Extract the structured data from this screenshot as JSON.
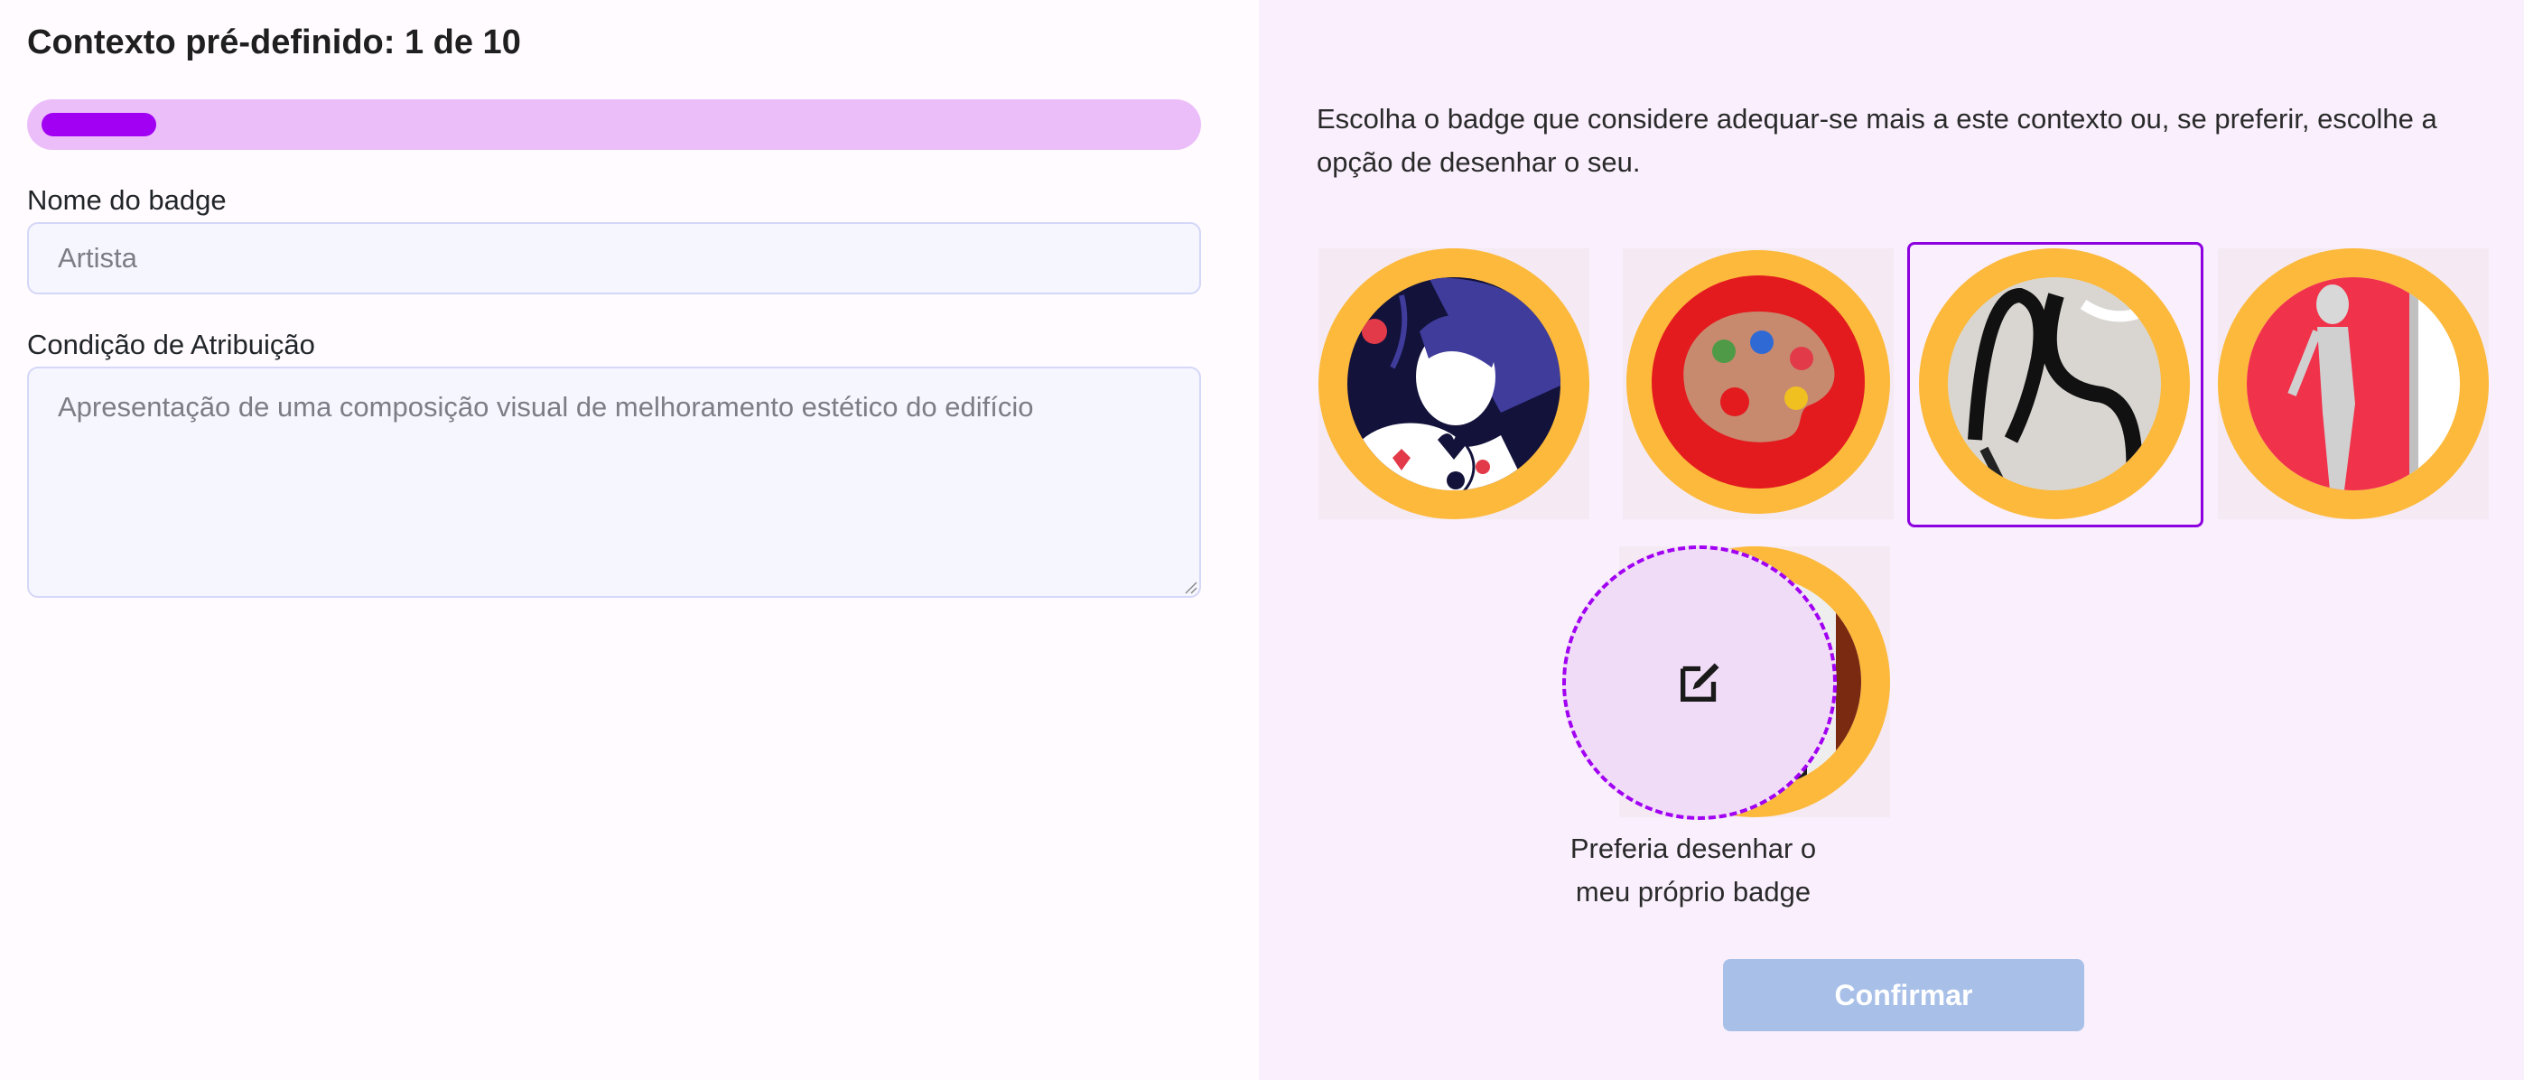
{
  "header": {
    "title": "Contexto pré-definido: 1 de 10"
  },
  "progress": {
    "current": 1,
    "total": 10,
    "fraction": 0.1
  },
  "form": {
    "name_label": "Nome do badge",
    "name_placeholder": "Artista",
    "condition_label": "Condição de Atribuição",
    "condition_placeholder": "Apresentação de uma composição visual de melhoramento estético do edifício"
  },
  "badges": {
    "intro": "Escolha o badge que considere adequar-se mais a este contexto ou, se preferir, escolhe a opção de desenhar o seu.",
    "options": [
      {
        "icon": "artist-woman-icon",
        "selected": false
      },
      {
        "icon": "paint-palette-icon",
        "selected": false
      },
      {
        "icon": "abstract-brush-icon",
        "selected": true
      },
      {
        "icon": "red-figure-painting-icon",
        "selected": false
      },
      {
        "icon": "pixel-painter-icon",
        "selected": false
      }
    ],
    "draw_own_label": "Preferia desenhar o meu próprio badge",
    "draw_icon": "edit-icon"
  },
  "actions": {
    "confirm_label": "Confirmar"
  },
  "colors": {
    "accent": "#a100f3",
    "progress_track": "#ebbefa",
    "badge_ring": "#fcb93b",
    "confirm_disabled": "#a8c0e8",
    "right_panel_bg": "#f9effd"
  }
}
